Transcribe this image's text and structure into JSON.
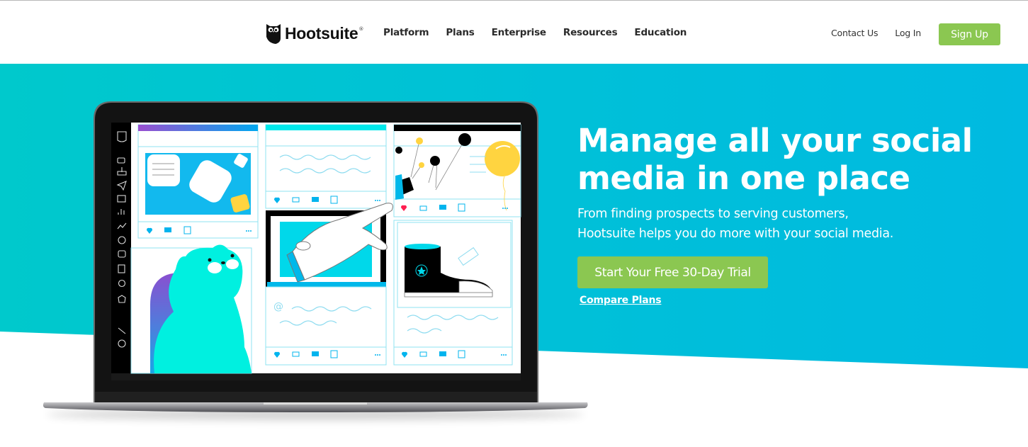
{
  "header": {
    "logo": {
      "text": "Hootsuite",
      "registered": "®",
      "icon": "owl-logo-icon"
    },
    "nav": [
      {
        "label": "Platform"
      },
      {
        "label": "Plans"
      },
      {
        "label": "Enterprise"
      },
      {
        "label": "Resources"
      },
      {
        "label": "Education"
      }
    ],
    "contact_label": "Contact Us",
    "login_label": "Log In",
    "signup_label": "Sign Up"
  },
  "hero": {
    "headline_line1": "Manage all your social",
    "headline_line2": "media in one place",
    "subtitle_line1": "From finding prospects to serving customers,",
    "subtitle_line2": "Hootsuite helps you do more with your social media.",
    "cta_label": "Start Your Free 30-Day Trial",
    "compare_label": "Compare Plans"
  },
  "illustration": {
    "sidebar_icons": [
      "owl-icon",
      "streams-icon",
      "inbox-icon",
      "publisher-icon",
      "planner-icon",
      "analytics-icon",
      "growth-icon",
      "compass-icon",
      "apps-icon",
      "clipboard-icon",
      "award-icon",
      "puzzle-icon",
      "wrench-icon",
      "help-icon"
    ],
    "post_action_icons": [
      "heart-icon",
      "retweet-icon",
      "comment-icon",
      "add-icon",
      "more-icon"
    ],
    "at_symbol": "@"
  },
  "colors": {
    "brand_green": "#8bc751",
    "hero_teal_left": "#00c9cc",
    "hero_blue_right": "#00bbe0",
    "text_dark": "#2b2b2b",
    "illustration_cyan": "#00f0e0",
    "illustration_blue": "#00b8f0",
    "balloon_yellow": "#ffd440",
    "heart_red": "#ff1e50"
  }
}
